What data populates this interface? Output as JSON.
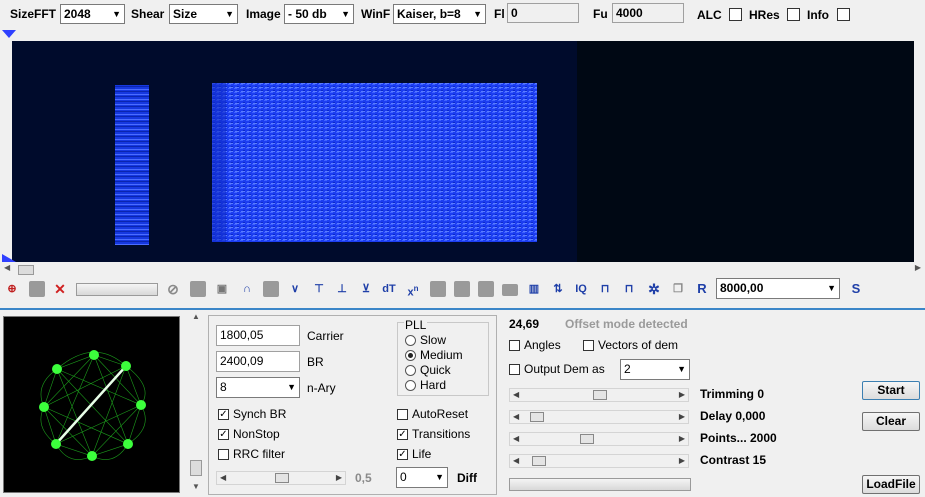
{
  "toolbar": {
    "sizefft_label": "SizeFFT",
    "sizefft_value": "2048",
    "shear_label": "Shear",
    "shear_value": "Size",
    "image_label": "Image",
    "image_value": "- 50 db",
    "winf_label": "WinF",
    "winf_value": "Kaiser, b=8",
    "fl_label": "Fl",
    "fl_value": "0",
    "fu_label": "Fu",
    "fu_value": "4000",
    "alc_label": "ALC",
    "alc_checked": false,
    "hres_label": "HRes",
    "hres_checked": false,
    "info_label": "Info",
    "info_checked": false
  },
  "spectrogram": {
    "background": "#000814",
    "signal_color": "#1a3cff"
  },
  "icon_bar": {
    "icons": [
      "zoom-icon",
      "page-icon",
      "delete-icon",
      "progress-bar",
      "no-icon",
      "page-icon",
      "square-icon",
      "arch-icon",
      "page-icon",
      "v-icon",
      "up-arrow-icon",
      "down-arrow-icon",
      "down-arrow2-icon",
      "dt-icon",
      "x-squared-icon",
      "gray-block",
      "gray-block",
      "gray-block",
      "gray-block",
      "bars-icon",
      "iq-arrows-icon",
      "iq-icon",
      "meander-icon",
      "meander2-icon",
      "gear-icon",
      "copy-icon",
      "r-icon",
      "frequency-combo",
      "s-icon"
    ],
    "frequency_value": "8000,00",
    "dt_label": "dT",
    "x2_label": "x",
    "x2_sup": "n",
    "iq_label": "IQ",
    "r_label": "R",
    "s_label": "S"
  },
  "demod": {
    "carrier_value": "1800,05",
    "carrier_label": "Carrier",
    "br_value": "2400,09",
    "br_label": "BR",
    "nary_value": "8",
    "nary_label": "n-Ary",
    "pll_label": "PLL",
    "pll_options": [
      {
        "label": "Slow",
        "selected": false
      },
      {
        "label": "Medium",
        "selected": true
      },
      {
        "label": "Quick",
        "selected": false
      },
      {
        "label": "Hard",
        "selected": false
      }
    ],
    "synch_br_label": "Synch BR",
    "synch_br_checked": true,
    "nonstop_label": "NonStop",
    "nonstop_checked": true,
    "rrc_label": "RRC filter",
    "rrc_checked": false,
    "autoreset_label": "AutoReset",
    "autoreset_checked": false,
    "transitions_label": "Transitions",
    "transitions_checked": true,
    "life_label": "Life",
    "life_checked": true,
    "rrc_slider_value": "0,5",
    "diff_value": "0",
    "diff_label": "Diff"
  },
  "right_panel": {
    "offset_value": "24,69",
    "offset_status": "Offset mode detected",
    "angles_label": "Angles",
    "angles_checked": false,
    "vectors_label": "Vectors of dem",
    "vectors_checked": false,
    "output_dem_label": "Output Dem as",
    "output_dem_checked": false,
    "output_dem_value": "2",
    "trimming_label": "Trimming 0",
    "delay_label": "Delay  0,000",
    "points_label": "Points... 2000",
    "contrast_label": "Contrast 15",
    "start_label": "Start",
    "clear_label": "Clear",
    "loadfile_label": "LoadFile"
  },
  "colors": {
    "constellation_color": "#2aff2a",
    "accent_blue": "#1f3fa8"
  }
}
